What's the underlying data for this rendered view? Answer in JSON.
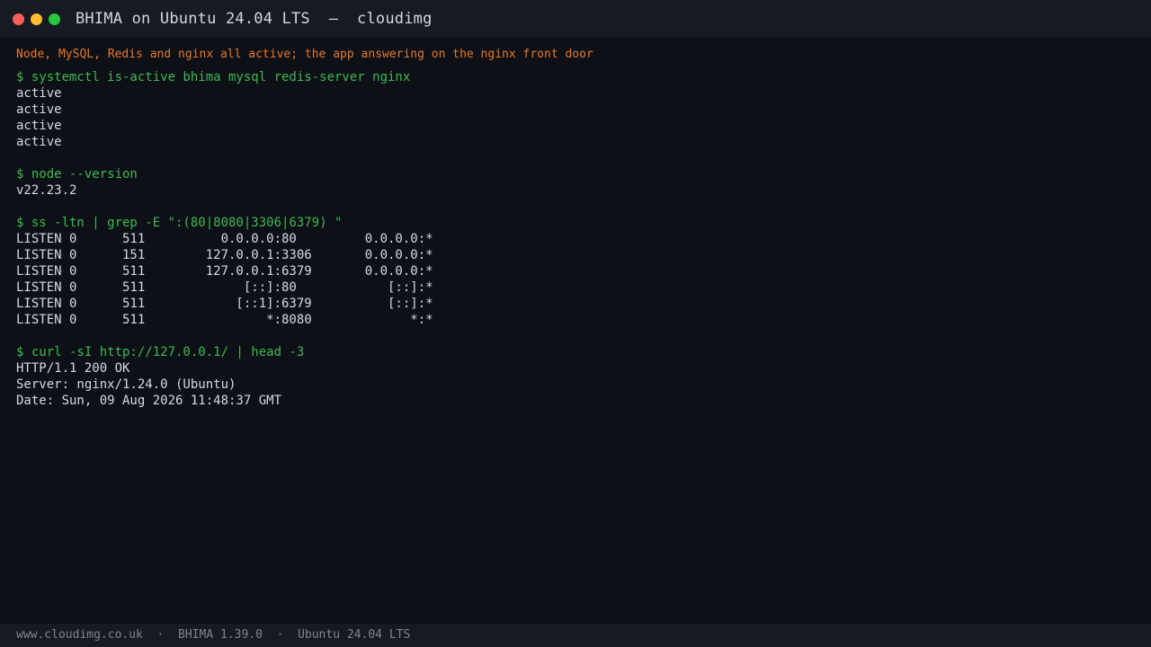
{
  "window": {
    "title": "BHIMA on Ubuntu 24.04 LTS  —  cloudimg",
    "controls": [
      "close-icon",
      "minimize-icon",
      "maximize-icon"
    ],
    "colors": {
      "close": "#ff5f57",
      "minimize": "#febc2e",
      "maximize": "#28c840"
    }
  },
  "caption": "Node, MySQL, Redis and nginx all active; the app answering on the nginx front door",
  "terminal": {
    "lines": [
      {
        "type": "cmd",
        "text": "$ systemctl is-active bhima mysql redis-server nginx"
      },
      {
        "type": "out",
        "text": "active"
      },
      {
        "type": "out",
        "text": "active"
      },
      {
        "type": "out",
        "text": "active"
      },
      {
        "type": "out",
        "text": "active"
      },
      {
        "type": "blank",
        "text": ""
      },
      {
        "type": "cmd",
        "text": "$ node --version"
      },
      {
        "type": "out",
        "text": "v22.23.2"
      },
      {
        "type": "blank",
        "text": ""
      },
      {
        "type": "cmd",
        "text": "$ ss -ltn | grep -E \":(80|8080|3306|6379) \""
      },
      {
        "type": "out",
        "text": "LISTEN 0      511          0.0.0.0:80         0.0.0.0:*"
      },
      {
        "type": "out",
        "text": "LISTEN 0      151        127.0.0.1:3306       0.0.0.0:*"
      },
      {
        "type": "out",
        "text": "LISTEN 0      511        127.0.0.1:6379       0.0.0.0:*"
      },
      {
        "type": "out",
        "text": "LISTEN 0      511             [::]:80            [::]:*"
      },
      {
        "type": "out",
        "text": "LISTEN 0      511            [::1]:6379          [::]:*"
      },
      {
        "type": "out",
        "text": "LISTEN 0      511                *:8080             *:*"
      },
      {
        "type": "blank",
        "text": ""
      },
      {
        "type": "cmd",
        "text": "$ curl -sI http://127.0.0.1/ | head -3"
      },
      {
        "type": "out",
        "text": "HTTP/1.1 200 OK"
      },
      {
        "type": "out",
        "text": "Server: nginx/1.24.0 (Ubuntu)"
      },
      {
        "type": "out",
        "text": "Date: Sun, 09 Aug 2026 11:48:37 GMT"
      }
    ]
  },
  "footer": {
    "text": "www.cloudimg.co.uk  ·  BHIMA 1.39.0  ·  Ubuntu 24.04 LTS"
  },
  "colors": {
    "background": "#0d1017",
    "titlebar": "#161a22",
    "command": "#3fb950",
    "output": "#d7dae0",
    "caption": "#e8792b",
    "footer_text": "#7d8590"
  }
}
